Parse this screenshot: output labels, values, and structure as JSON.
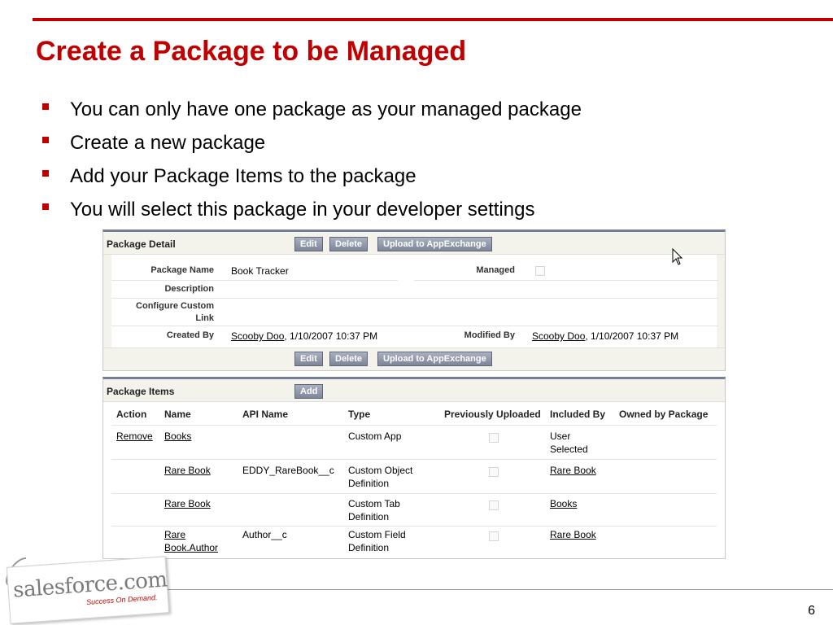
{
  "slide": {
    "title": "Create a Package to be Managed",
    "page_number": "6",
    "bullets": [
      "You can only have one package as your managed package",
      "Create a new package",
      "Add your Package Items to the package",
      "You will select this package in your developer settings"
    ]
  },
  "package_detail": {
    "title": "Package Detail",
    "buttons": {
      "edit": "Edit",
      "delete": "Delete",
      "upload": "Upload to AppExchange"
    },
    "labels": {
      "package_name": "Package Name",
      "managed": "Managed",
      "description": "Description",
      "configure_line1": "Configure Custom",
      "configure_line2": "Link",
      "created_by": "Created By",
      "modified_by": "Modified By"
    },
    "values": {
      "package_name": "Book Tracker",
      "managed": false,
      "description": "",
      "configure_link": "",
      "created_by_user": "Scooby Doo",
      "created_by_date": ", 1/10/2007 10:37 PM",
      "modified_by_user": "Scooby Doo",
      "modified_by_date": ", 1/10/2007 10:37 PM"
    }
  },
  "package_items": {
    "title": "Package Items",
    "add_label": "Add",
    "columns": [
      "Action",
      "Name",
      "API Name",
      "Type",
      "Previously Uploaded",
      "Included By",
      "Owned by Package"
    ],
    "rows": [
      {
        "action": "Remove",
        "name1": "Books",
        "name2": "",
        "api": "",
        "type1": "Custom App",
        "type2": "",
        "prev": false,
        "inc1": "User",
        "inc2": "Selected",
        "inc_link": false
      },
      {
        "action": "",
        "name1": "Rare Book",
        "name2": "",
        "api": "EDDY_RareBook__c",
        "type1": "Custom Object",
        "type2": "Definition",
        "prev": false,
        "inc1": "Rare Book",
        "inc2": "",
        "inc_link": true
      },
      {
        "action": "",
        "name1": "Rare Book",
        "name2": "",
        "api": "",
        "type1": "Custom Tab",
        "type2": "Definition",
        "prev": false,
        "inc1": "Books",
        "inc2": "",
        "inc_link": true
      },
      {
        "action": "",
        "name1": "Rare",
        "name2": "Book.Author",
        "api": "Author__c",
        "type1": "Custom Field",
        "type2": "Definition",
        "prev": false,
        "inc1": "Rare Book",
        "inc2": "",
        "inc_link": true
      }
    ]
  },
  "logo": {
    "wordmark": "salesforce.com",
    "tagline": "Success On Demand."
  },
  "colors": {
    "accent": "#c00000",
    "panel_border": "#747e96",
    "panel_bg": "#f3f3ec",
    "button": "#7d8699"
  }
}
